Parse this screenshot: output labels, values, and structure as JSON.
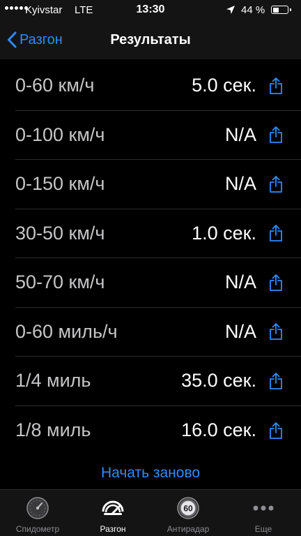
{
  "status_bar": {
    "carrier": "Kyivstar",
    "network": "LTE",
    "time": "13:30",
    "battery_percent": "44 %",
    "battery_level": 0.44
  },
  "nav": {
    "back_label": "Разгон",
    "title": "Результаты"
  },
  "results": [
    {
      "label": "0-60 км/ч",
      "value": "5.0 сек."
    },
    {
      "label": "0-100 км/ч",
      "value": "N/A"
    },
    {
      "label": "0-150 км/ч",
      "value": "N/A"
    },
    {
      "label": "30-50 км/ч",
      "value": "1.0 сек."
    },
    {
      "label": "50-70 км/ч",
      "value": "N/A"
    },
    {
      "label": "0-60 миль/ч",
      "value": "N/A"
    },
    {
      "label": "1/4 миль",
      "value": "35.0 сек."
    },
    {
      "label": "1/8 миль",
      "value": "16.0 сек."
    }
  ],
  "restart_label": "Начать заново",
  "tabs": [
    {
      "label": "Спидометр",
      "icon": "speedometer-icon",
      "active": false
    },
    {
      "label": "Разгон",
      "icon": "acceleration-icon",
      "active": true
    },
    {
      "label": "Антирадар",
      "icon": "speed-limit-60-icon",
      "badge": "60",
      "active": false
    },
    {
      "label": "Еще",
      "icon": "more-icon",
      "active": false
    }
  ],
  "colors": {
    "accent": "#2f8cff",
    "background": "#000000",
    "bar": "#141414",
    "label": "#c6c6c8",
    "inactive_tab": "#8e8e93"
  }
}
